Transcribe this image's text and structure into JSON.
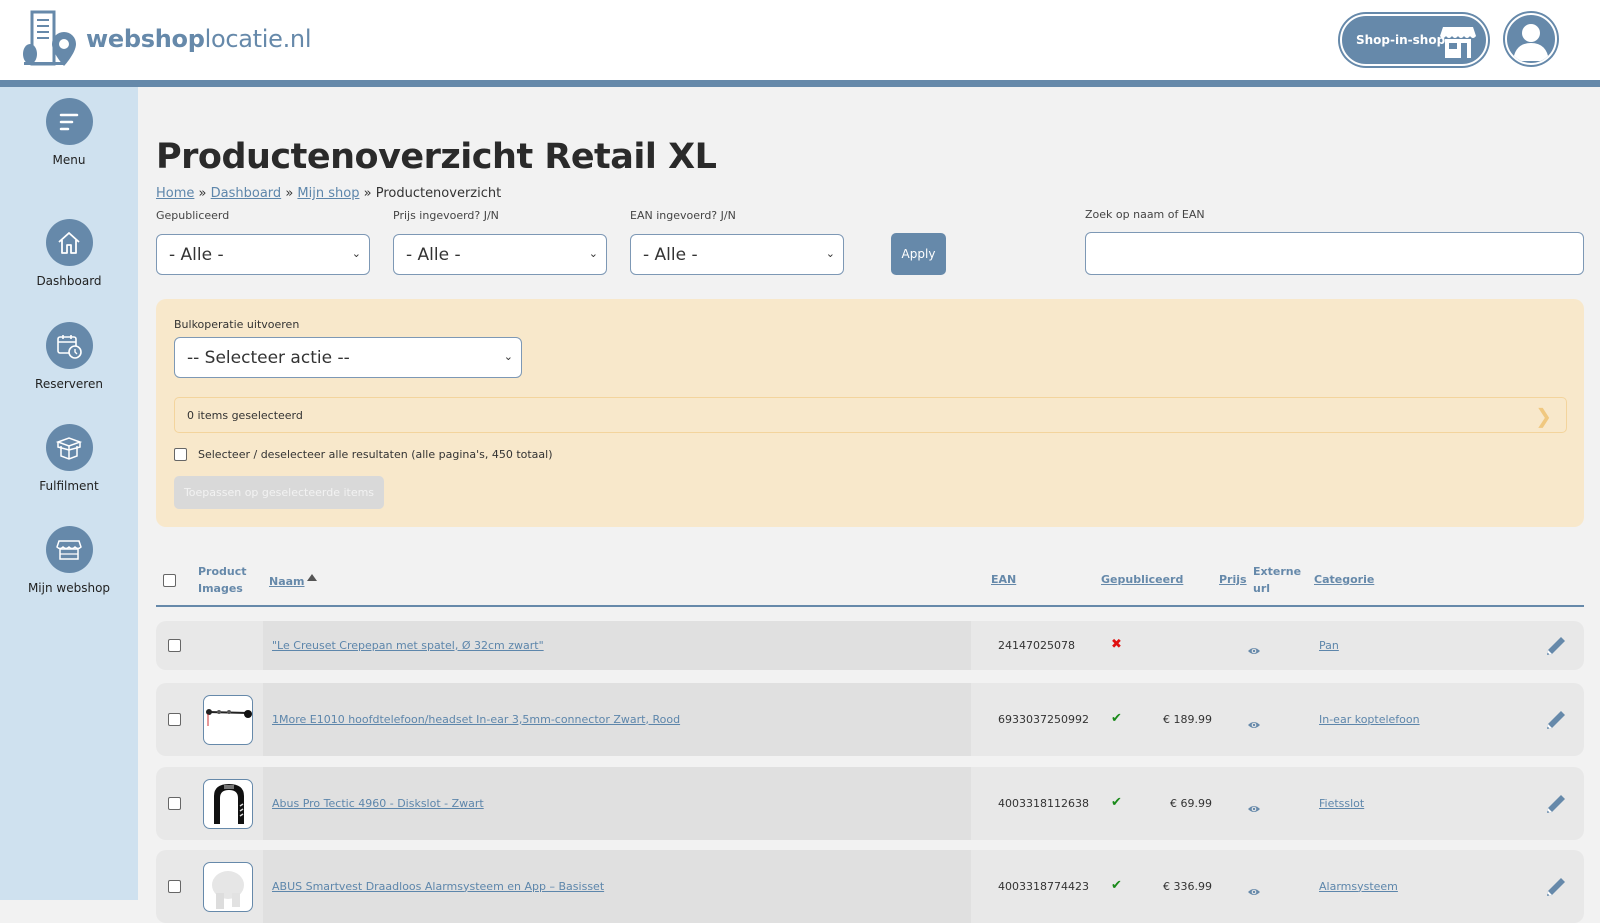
{
  "header": {
    "logo_bold": "webshop",
    "logo_light": "locatie.nl",
    "shop_in_shop_label": "Shop-in-shop",
    "icons": {
      "shop": "storefront-icon",
      "user": "user-avatar-icon"
    }
  },
  "sidebar": {
    "items": [
      {
        "label": "Menu",
        "icon": "menu-icon"
      },
      {
        "label": "Dashboard",
        "icon": "home-icon"
      },
      {
        "label": "Reserveren",
        "icon": "calendar-clock-icon"
      },
      {
        "label": "Fulfilment",
        "icon": "box-icon"
      },
      {
        "label": "Mijn webshop",
        "icon": "storefront-icon"
      }
    ]
  },
  "page": {
    "title": "Productenoverzicht Retail XL",
    "breadcrumb": [
      {
        "label": "Home",
        "link": true
      },
      {
        "label": "Dashboard",
        "link": true
      },
      {
        "label": "Mijn shop",
        "link": true
      },
      {
        "label": "Productenoverzicht",
        "link": false
      }
    ],
    "breadcrumb_separator": "»"
  },
  "filters": {
    "published": {
      "label": "Gepubliceerd",
      "value": "- Alle -"
    },
    "price": {
      "label": "Prijs ingevoerd? J/N",
      "value": "- Alle -"
    },
    "ean": {
      "label": "EAN ingevoerd? J/N",
      "value": "- Alle -"
    },
    "apply_label": "Apply",
    "search": {
      "label": "Zoek op naam of EAN",
      "value": "",
      "placeholder": ""
    }
  },
  "bulk": {
    "label": "Bulkoperatie uitvoeren",
    "action_value": "-- Selecteer actie --",
    "selected_text": "0 items geselecteerd",
    "select_all_text": "Selecteer / deselecteer alle resultaten (alle pagina's, 450 totaal)",
    "apply_selected_label": "Toepassen op geselecteerde items"
  },
  "table": {
    "headers": {
      "images_line1": "Product",
      "images_line2": "Images",
      "name": "Naam",
      "ean": "EAN",
      "published": "Gepubliceerd",
      "price": "Prijs",
      "external_line1": "Externe",
      "external_line2": "url",
      "category": "Categorie"
    },
    "rows": [
      {
        "name": "\"Le Creuset Crepepan met spatel, Ø 32cm zwart\"",
        "ean": "24147025078",
        "published": false,
        "published_symbol": "✖",
        "price": "",
        "category": "Pan",
        "has_image": false,
        "image": ""
      },
      {
        "name": "1More E1010 hoofdtelefoon/headset In-ear 3,5mm-connector Zwart, Rood",
        "ean": "6933037250992",
        "published": true,
        "published_symbol": "✔",
        "price": "€ 189.99",
        "category": "In-ear koptelefoon",
        "has_image": true,
        "image": "earphones"
      },
      {
        "name": "Abus Pro Tectic 4960 - Diskslot - Zwart",
        "ean": "4003318112638",
        "published": true,
        "published_symbol": "✔",
        "price": "€ 69.99",
        "category": "Fietsslot",
        "has_image": true,
        "image": "bike-lock"
      },
      {
        "name": "ABUS Smartvest Draadloos Alarmsysteem en App – Basisset",
        "ean": "4003318774423",
        "published": true,
        "published_symbol": "✔",
        "price": "€ 336.99",
        "category": "Alarmsysteem",
        "has_image": true,
        "image": "alarm-system"
      }
    ]
  },
  "colors": {
    "brand": "#6689aa",
    "sidebar_bg": "#cfe1ef",
    "bulk_bg": "#f8e8cb",
    "published_yes": "#1a8a1a",
    "published_no": "#e01010"
  }
}
